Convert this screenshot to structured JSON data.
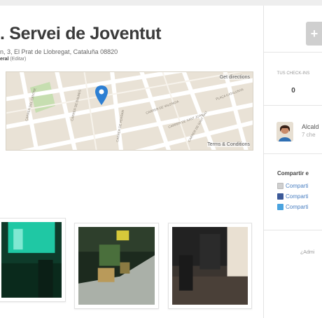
{
  "place": {
    "title": ". Servei de Joventut",
    "address": "n, 3, El Prat de Llobregat, Cataluña 08820",
    "category": "eral",
    "edit_label": "(Editar)"
  },
  "map": {
    "get_directions": "Get directions",
    "terms": "Terms & Conditions",
    "street_labels": [
      "CARRER DEL CENTRE",
      "CARRER DE BALMES",
      "CARRER DE VALENCIA",
      "CARRER DE SANT JOAN",
      "PLAÇA CATALUNYA",
      "CARRER DE FERRAN",
      "CARRER DE SANT PAU"
    ]
  },
  "sidebar": {
    "stat_label": "TUS CHECK-INS",
    "stat_value": "0",
    "user_name": "Alcald",
    "user_checkins": "7 che",
    "share_heading": "Compartir e",
    "share_items": [
      {
        "label": "Comparti",
        "icon": "email-icon",
        "color": "#cfcfcf"
      },
      {
        "label": "Comparti",
        "icon": "facebook-icon",
        "color": "#3b5998"
      },
      {
        "label": "Comparti",
        "icon": "twitter-icon",
        "color": "#4aa3df"
      }
    ],
    "admin_link": "¿Admi"
  },
  "colors": {
    "link": "#4a7fc1",
    "map_pin": "#2d7fd3",
    "park": "#c6deb0"
  }
}
